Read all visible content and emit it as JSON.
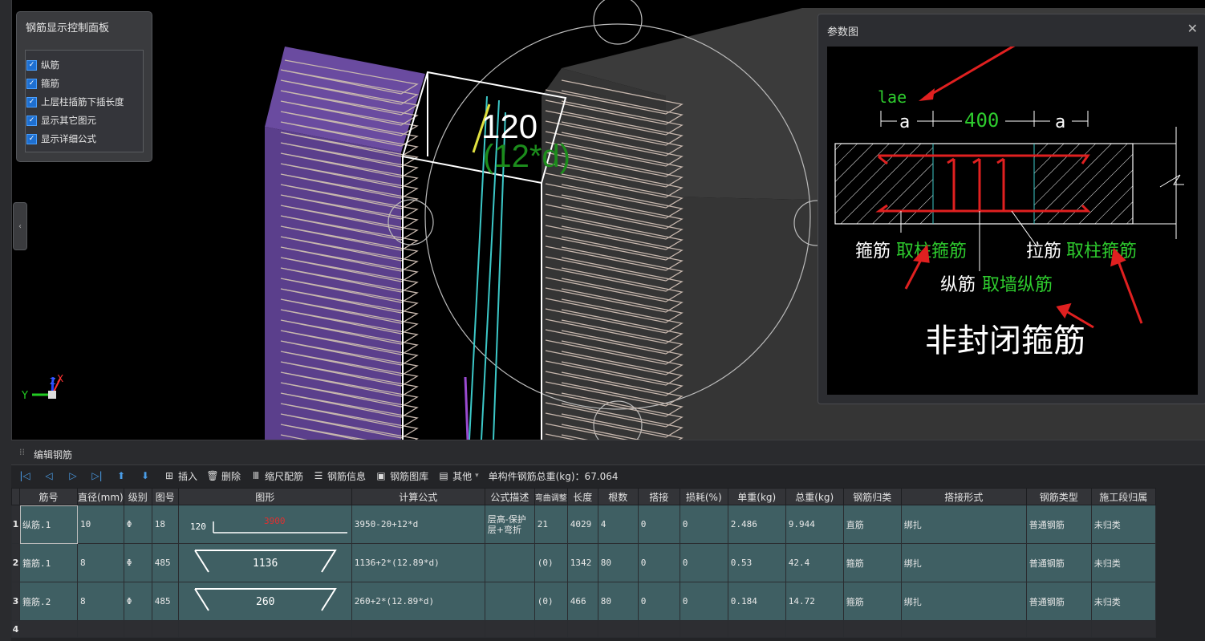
{
  "control_panel": {
    "title": "钢筋显示控制面板",
    "options": [
      {
        "label": "纵筋",
        "checked": true
      },
      {
        "label": "箍筋",
        "checked": true
      },
      {
        "label": "上层柱插筋下插长度",
        "checked": true
      },
      {
        "label": "显示其它图元",
        "checked": true
      },
      {
        "label": "显示详细公式",
        "checked": true
      }
    ]
  },
  "viewport": {
    "dim_value": "120",
    "dim_formula": "(12*d)",
    "axis_y": "Y",
    "axis_x": "X",
    "axis_z": "Z",
    "colors": {
      "wall": "#5b3f8c",
      "beam": "#3b3b3b",
      "rebar": "#d8c8bc",
      "dim": "#ffffff",
      "formula": "#1c8c1c",
      "stirrup": "#3cc8c8"
    }
  },
  "param_window": {
    "title": "参数图",
    "close_icon": "close-icon",
    "diagram": {
      "lae": "lae",
      "a_left": "a",
      "mid": "400",
      "a_right": "a",
      "label1_white": "箍筋",
      "label1_green": "取柱箍筋",
      "label2_white": "拉筋",
      "label2_green": "取柱箍筋",
      "label3_white": "纵筋",
      "label3_green": "取墙纵筋",
      "big_caption": "非封闭箍筋"
    }
  },
  "bottom_panel": {
    "title": "编辑钢筋",
    "toolbar": {
      "insert": "插入",
      "delete": "删除",
      "scale_config": "缩尺配筋",
      "rebar_info": "钢筋信息",
      "rebar_library": "钢筋图库",
      "other": "其他",
      "total_weight": "单构件钢筋总重(kg)：67.064"
    },
    "columns": [
      "筋号",
      "直径(mm)",
      "级别",
      "图号",
      "图形",
      "计算公式",
      "公式描述",
      "弯曲调整",
      "长度",
      "根数",
      "搭接",
      "损耗(%)",
      "单重(kg)",
      "总重(kg)",
      "钢筋归类",
      "搭接形式",
      "钢筋类型",
      "施工段归属"
    ],
    "rows": [
      {
        "no": "1",
        "name": "纵筋.1",
        "dia": "10",
        "grade": "Φ",
        "fig": "18",
        "shape_left": "120",
        "shape_mid": "3900",
        "formula": "3950-20+12*d",
        "desc": "层高-保护层+弯折",
        "bend": "21",
        "length": "4029",
        "count": "4",
        "lap": "0",
        "loss": "0",
        "unit_w": "2.486",
        "total_w": "9.944",
        "category": "直筋",
        "lap_type": "绑扎",
        "type": "普通钢筋",
        "stage": "未归类"
      },
      {
        "no": "2",
        "name": "箍筋.1",
        "dia": "8",
        "grade": "Φ",
        "fig": "485",
        "shape_left": "",
        "shape_mid": "1136",
        "formula": "1136+2*(12.89*d)",
        "desc": "",
        "bend": "(0)",
        "length": "1342",
        "count": "80",
        "lap": "0",
        "loss": "0",
        "unit_w": "0.53",
        "total_w": "42.4",
        "category": "箍筋",
        "lap_type": "绑扎",
        "type": "普通钢筋",
        "stage": "未归类"
      },
      {
        "no": "3",
        "name": "箍筋.2",
        "dia": "8",
        "grade": "Φ",
        "fig": "485",
        "shape_left": "",
        "shape_mid": "260",
        "formula": "260+2*(12.89*d)",
        "desc": "",
        "bend": "(0)",
        "length": "466",
        "count": "80",
        "lap": "0",
        "loss": "0",
        "unit_w": "0.184",
        "total_w": "14.72",
        "category": "箍筋",
        "lap_type": "绑扎",
        "type": "普通钢筋",
        "stage": "未归类"
      }
    ],
    "empty_row_no": "4"
  }
}
